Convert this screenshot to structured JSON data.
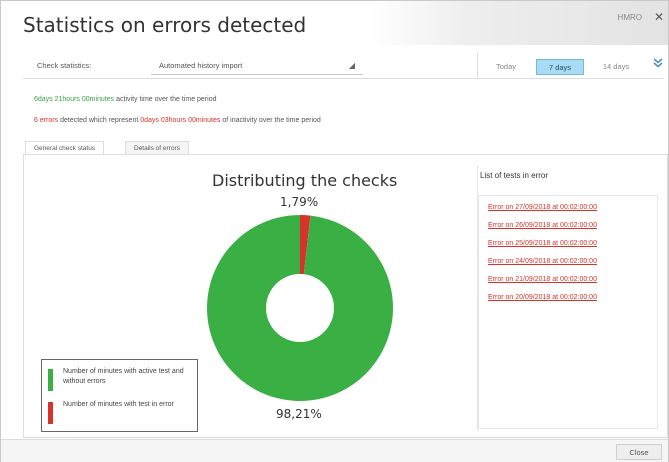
{
  "window": {
    "title": "Statistics on errors detected",
    "help_link": "HMRO",
    "close_glyph": "✕"
  },
  "filters": {
    "check_label": "Check statistics:",
    "selected_check": "Automated history import",
    "period_tabs": [
      "Today",
      "7 days",
      "14 days"
    ],
    "active_period": "7 days",
    "toggle_icon": "double-chevron-down-icon"
  },
  "summary": {
    "activity_highlight": "6days 21hours 00minutes",
    "activity_text": " activity time over the time period",
    "errors_highlight": "6 errors",
    "errors_text_mid": " detected which represent ",
    "inactivity_highlight": "0days 03hours 00minutes",
    "errors_text_end": " of inactivity over the time period"
  },
  "tabs": [
    "General check status",
    "Details of errors"
  ],
  "chart": {
    "title": "Distributing the checks",
    "top_label": "1,79%",
    "bottom_label": "98,21%"
  },
  "chart_data": {
    "type": "pie",
    "title": "Distributing the checks",
    "slices": [
      {
        "label": "Number of minutes with active test and without errors",
        "value": 98.21,
        "color": "#3ab044"
      },
      {
        "label": "Number of minutes with test in error",
        "value": 1.79,
        "color": "#d6332a"
      }
    ],
    "legend_position": "bottom-left"
  },
  "legend": [
    {
      "label": "Number of minutes with active test and without errors",
      "color": "#3ab044"
    },
    {
      "label": "Number of minutes with test in error",
      "color": "#d6332a"
    }
  ],
  "errors_panel": {
    "title": "List of tests in error",
    "items": [
      "Error on 27/09/2018 at 00:02:00:00",
      "Error on 26/09/2018 at 00:02:00:00",
      "Error on 25/09/2018 at 00:02:00:00",
      "Error on 24/09/2018 at 00:02:00:00",
      "Error on 21/09/2018 at 00:02:00:00",
      "Error on 20/09/2018 at 00:02:00:00"
    ]
  },
  "footer": {
    "close_label": "Close"
  }
}
